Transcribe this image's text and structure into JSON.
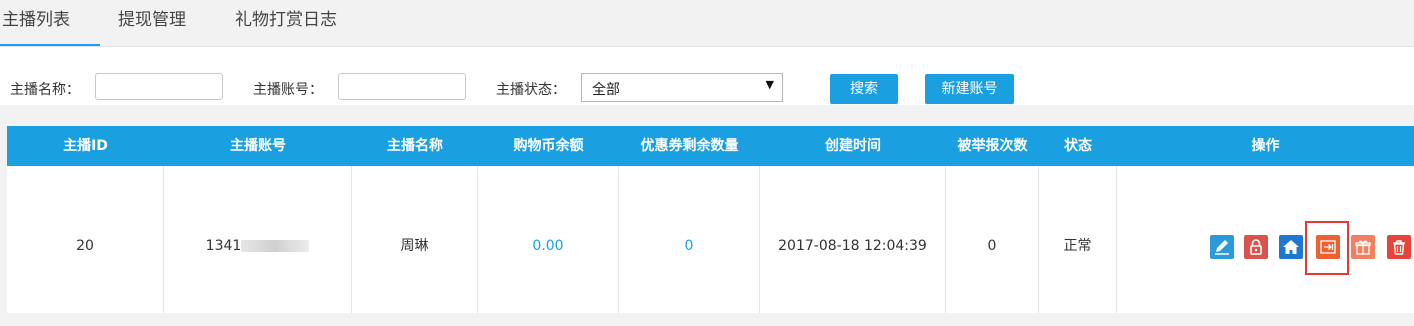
{
  "tabs": [
    {
      "label": "主播列表"
    },
    {
      "label": "提现管理"
    },
    {
      "label": "礼物打赏日志"
    }
  ],
  "search": {
    "name_label": "主播名称：",
    "name_value": "",
    "account_label": "主播账号：",
    "account_value": "",
    "status_label": "主播状态：",
    "status_selected": "全部",
    "search_button": "搜索",
    "new_button": "新建账号"
  },
  "table": {
    "headers": [
      "主播ID",
      "主播账号",
      "主播名称",
      "购物币余额",
      "优惠券剩余数量",
      "创建时间",
      "被举报次数",
      "状态",
      "操作"
    ],
    "rows": [
      {
        "id": "20",
        "account": "1341",
        "name": "周琳",
        "balance": "0.00",
        "coupons": "0",
        "created": "2017-08-18 12:04:39",
        "reports": "0",
        "status": "正常"
      }
    ]
  },
  "actions": [
    {
      "icon": "edit-icon",
      "color": "#2c9ad8"
    },
    {
      "icon": "lock-icon",
      "color": "#d9534f"
    },
    {
      "icon": "home-icon",
      "color": "#1e78d2"
    },
    {
      "icon": "transfer-icon",
      "color": "#ef6030"
    },
    {
      "icon": "gift-icon",
      "color": "#f08060"
    },
    {
      "icon": "trash-icon",
      "color": "#e8443a"
    }
  ],
  "colors": {
    "accent": "#1aa0e0",
    "highlight_border": "#e53935"
  }
}
